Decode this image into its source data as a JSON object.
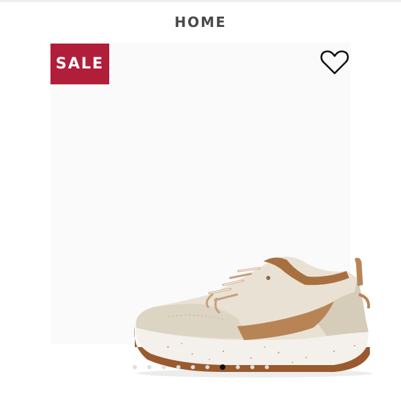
{
  "header": {
    "category": "HOME"
  },
  "product": {
    "badge": "SALE",
    "badge_color": "#b11e3a",
    "image_icon": "sneaker-photo",
    "favorite_icon": "heart-outline-icon"
  },
  "carousel": {
    "total_slides": 10,
    "active_index": 6
  }
}
